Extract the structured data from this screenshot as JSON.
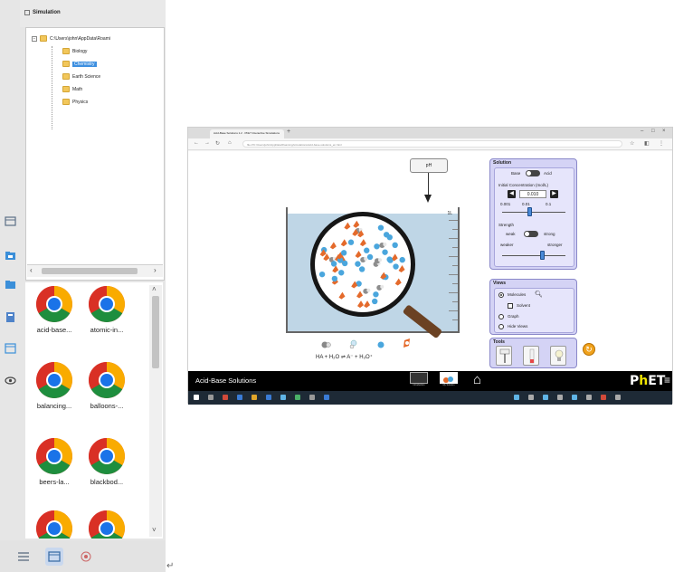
{
  "panel": {
    "header_title": "Simulation",
    "tree": {
      "root_path": "C:\\Users\\john\\AppData\\Roami",
      "collapse_glyph": "−",
      "children": [
        "Biology",
        "Chemistry",
        "Earth Science",
        "Math",
        "Physics"
      ],
      "selected": "Chemistry"
    },
    "files": [
      {
        "label": "acid-base..."
      },
      {
        "label": "atomic-in..."
      },
      {
        "label": "balancing..."
      },
      {
        "label": "balloons-..."
      },
      {
        "label": "beers-la..."
      },
      {
        "label": "blackbod..."
      },
      {
        "label": ""
      },
      {
        "label": ""
      }
    ],
    "rail_icons": [
      "grid-icon",
      "folder-icon",
      "folder-icon",
      "book-icon",
      "calendar-icon",
      "eye-icon"
    ],
    "bottom_icons": [
      "list-view-icon",
      "window-icon",
      "close-circle-icon"
    ]
  },
  "browser": {
    "tab_title": "Acid-Base Solutions 1.2 · PhET Interactive Simulations",
    "url": "file:///C:/Users/john/AppData/Roaming/simulations/acid-base-solutions_en.html",
    "sim": {
      "probe_label": "pH",
      "beaker_volume_label": "1L",
      "equation": "HA + H₂O ⇌ A⁻ + H₃O⁺",
      "nav_title": "Acid-Base Solutions",
      "screen_labels": [
        "Introduction",
        "My Solution"
      ],
      "logo_p": "P",
      "logo_h": "h",
      "logo_et": "ET",
      "solution": {
        "title": "Solution",
        "toggle_left": "Base",
        "toggle_right": "Acid",
        "concentration_label": "Initial Concentration (mol/L)",
        "concentration_value": "0.010",
        "scale_ticks": [
          "0.001",
          "0.01",
          "0.1"
        ],
        "strength_label": "Strength",
        "strength_left": "weak",
        "strength_right": "strong",
        "strength_scale_left": "weaker",
        "strength_scale_right": "stronger"
      },
      "views": {
        "title": "Views",
        "options": [
          "Molecules",
          "Solvent",
          "Graph",
          "Hide Views"
        ],
        "selected": "Molecules"
      },
      "tools": {
        "title": "Tools",
        "items": [
          "pH meter",
          "pH paper",
          "conductivity tester"
        ]
      }
    }
  },
  "colors": {
    "panel_bg": "#d4d3f5",
    "panel_border": "#8a88c9",
    "acid_orange": "#e46a2b",
    "water_blue": "#4aa6dd",
    "selected_blue": "#3d8fe0",
    "navbar_bg": "#000000",
    "taskbar_bg": "#1e2a36"
  }
}
